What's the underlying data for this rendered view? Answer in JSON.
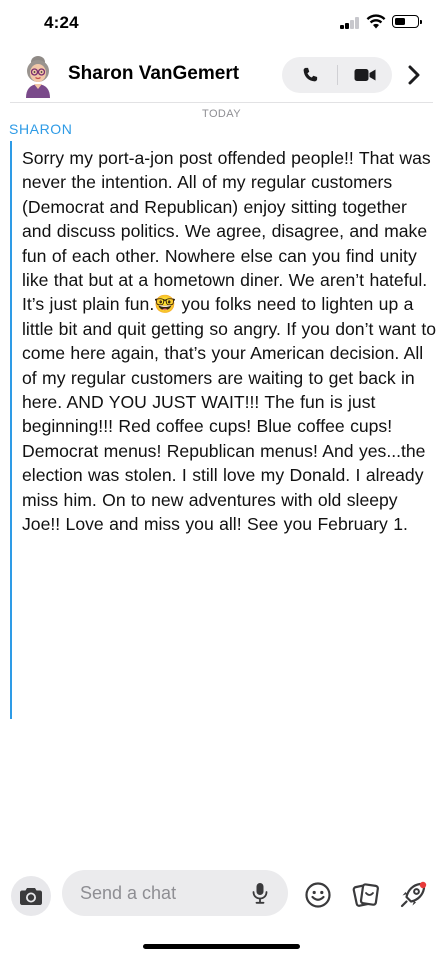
{
  "status_bar": {
    "time": "4:24"
  },
  "header": {
    "contact_name": "Sharon VanGemert"
  },
  "chat": {
    "date_label": "TODAY",
    "sender": "SHARON",
    "message": "Sorry my port-a-jon post offended people!! That was never the intention. All of my regular customers (Democrat and Republican) enjoy sitting together and discuss politics. We agree, disagree, and make fun of each other. Nowhere else can you find unity like that  but at a hometown diner. We aren’t hateful. It’s just plain fun.🤓 you folks need to lighten up a little bit and quit getting so angry. If you don’t want to come here again, that’s your American decision. All of my regular customers are waiting to get back in here. AND YOU JUST WAIT!!! The fun is just beginning!!! Red coffee cups! Blue coffee cups! Democrat menus! Republican menus! And yes...the election was stolen. I still love my Donald. I already miss him. On to new adventures with old sleepy Joe!! Love and miss you all! See you February 1."
  },
  "composer": {
    "placeholder": "Send a chat"
  },
  "colors": {
    "accent": "#2e9be6",
    "sender": "#2e9be6",
    "notification_dot": "#e83a3a"
  },
  "icons": [
    "phone-icon",
    "video-icon",
    "chevron-right-icon",
    "camera-icon",
    "microphone-icon",
    "emoji-icon",
    "stickers-icon",
    "rocket-icon"
  ]
}
